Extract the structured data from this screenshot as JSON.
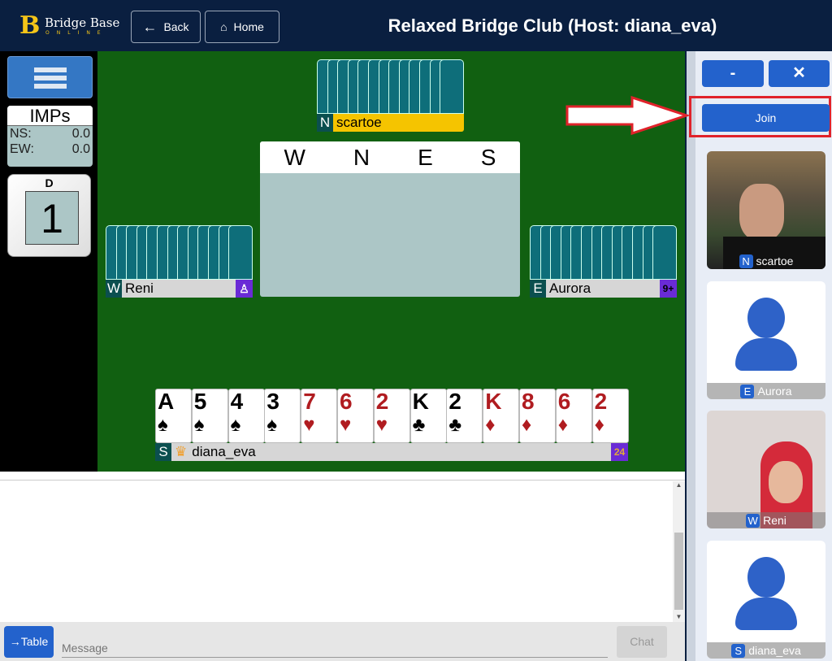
{
  "header": {
    "logo_main": "Bridge Base",
    "logo_sub": "ONLINE",
    "back": "Back",
    "home": "Home",
    "title": "Relaxed Bridge Club (Host: diana_eva)"
  },
  "score": {
    "type": "IMPs",
    "ns_label": "NS:",
    "ns": "0.0",
    "ew_label": "EW:",
    "ew": "0.0"
  },
  "board": {
    "dealer": "D",
    "number": "1"
  },
  "players": {
    "north": {
      "seat": "N",
      "name": "scartoe"
    },
    "west": {
      "seat": "W",
      "name": "Reni"
    },
    "east": {
      "seat": "E",
      "name": "Aurora",
      "badge": "9+"
    },
    "south": {
      "seat": "S",
      "name": "diana_eva",
      "badge": "24"
    }
  },
  "bidding": {
    "headers": [
      "W",
      "N",
      "E",
      "S"
    ]
  },
  "south_hand": [
    {
      "rank": "A",
      "suit": "♠"
    },
    {
      "rank": "5",
      "suit": "♠"
    },
    {
      "rank": "4",
      "suit": "♠"
    },
    {
      "rank": "3",
      "suit": "♠"
    },
    {
      "rank": "7",
      "suit": "♥"
    },
    {
      "rank": "6",
      "suit": "♥"
    },
    {
      "rank": "2",
      "suit": "♥"
    },
    {
      "rank": "K",
      "suit": "♣"
    },
    {
      "rank": "2",
      "suit": "♣"
    },
    {
      "rank": "K",
      "suit": "♦"
    },
    {
      "rank": "8",
      "suit": "♦"
    },
    {
      "rank": "6",
      "suit": "♦"
    },
    {
      "rank": "2",
      "suit": "♦"
    }
  ],
  "right_panel": {
    "minimize": "-",
    "close": "✕",
    "join": "Join",
    "videos": [
      {
        "seat": "N",
        "name": "scartoe"
      },
      {
        "seat": "E",
        "name": "Aurora"
      },
      {
        "seat": "W",
        "name": "Reni"
      },
      {
        "seat": "S",
        "name": "diana_eva"
      }
    ]
  },
  "chat": {
    "to_table": "→Table",
    "placeholder": "Message",
    "send": "Chat"
  },
  "colors": {
    "header": "#0a1f40",
    "table": "#116011",
    "accent": "#2362cc",
    "red_suit": "#b01c20",
    "highlight": "#e0222a"
  }
}
